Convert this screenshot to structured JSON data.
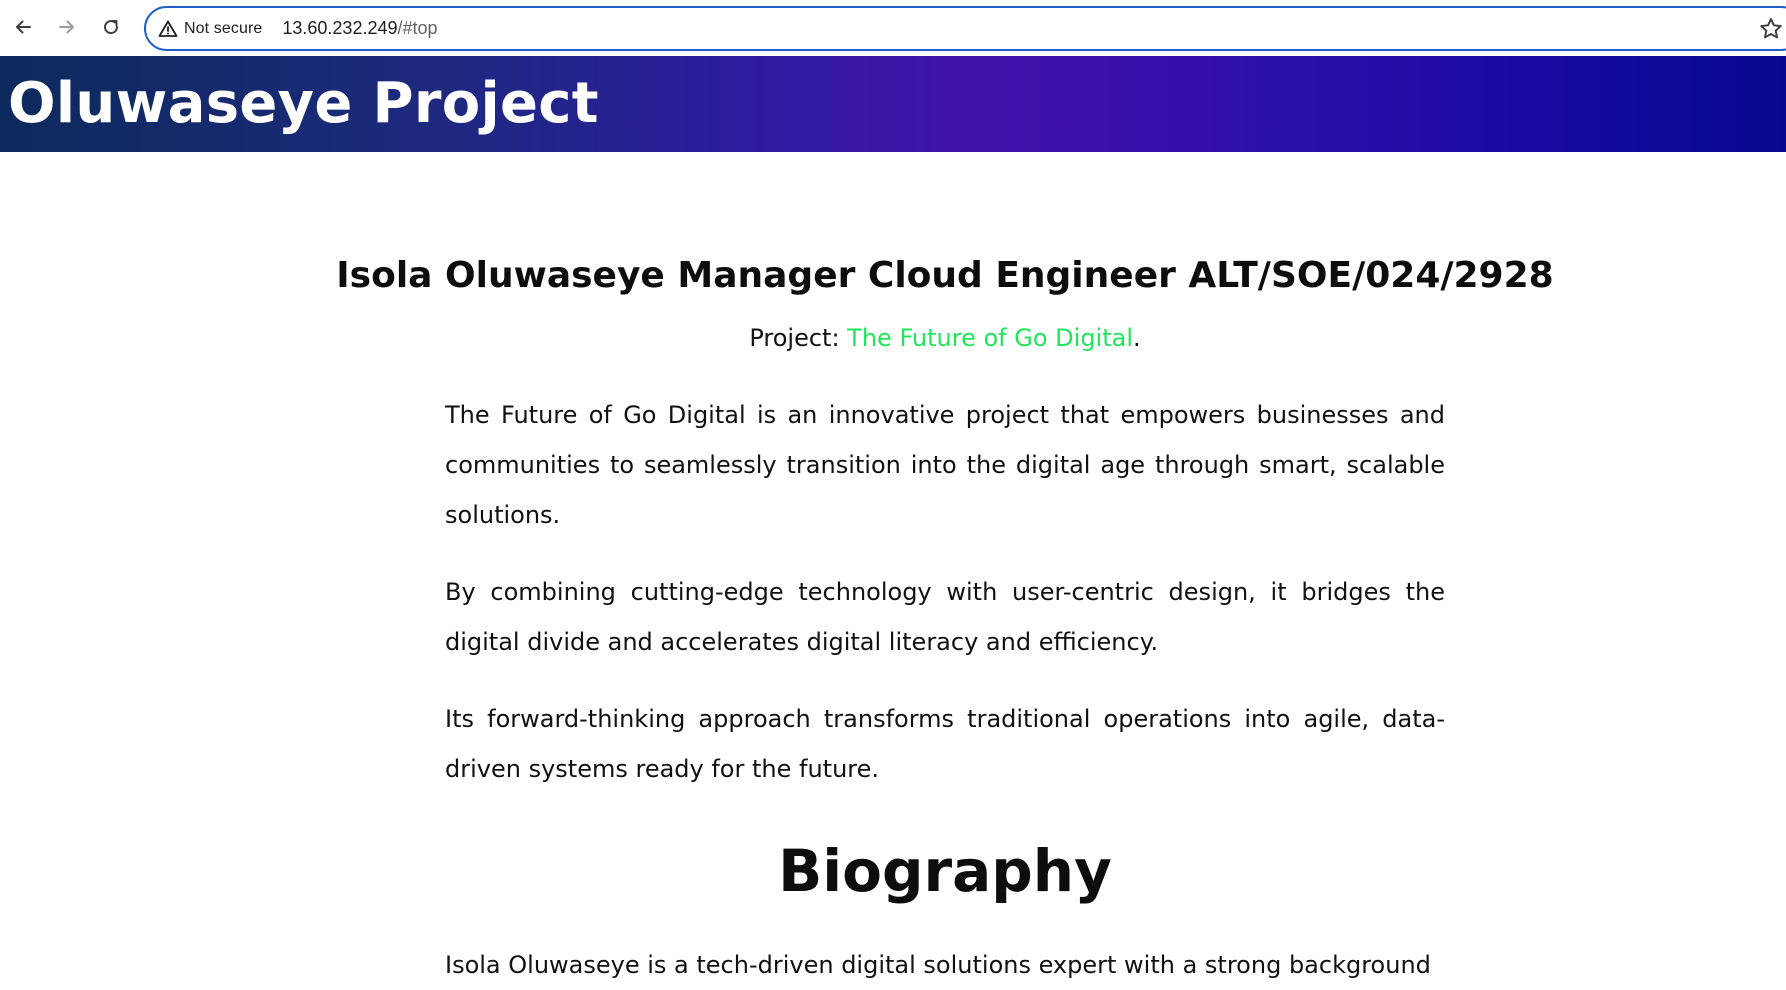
{
  "browser": {
    "back_icon": "arrow-left-icon",
    "forward_icon": "arrow-right-icon",
    "reload_icon": "reload-icon",
    "security_icon": "warning-triangle-icon",
    "security_label": "Not secure",
    "url_host": "13.60.232.249",
    "url_rest": "/#top",
    "bookmark_icon": "star-icon"
  },
  "header": {
    "title": "Oluwaseye Project",
    "gradient_colors": [
      "#0c2a5c",
      "#4312ab",
      "#07088f"
    ]
  },
  "main": {
    "author_heading": "Isola Oluwaseye Manager Cloud Engineer ALT/SOE/024/2928",
    "project_prefix": "Project: ",
    "project_name": "The Future of Go Digital",
    "project_suffix": ".",
    "project_link_color": "#1ee85a",
    "paragraphs": [
      "The Future of Go Digital is an innovative project that empowers businesses and communities to seamlessly transition into the digital age through smart, scalable solutions.",
      "By combining cutting-edge technology with user-centric design, it bridges the digital divide and accelerates digital literacy and efficiency.",
      "Its forward-thinking approach transforms traditional operations into agile, data-driven systems ready for the future."
    ],
    "biography_heading": "Biography",
    "biography_text": "Isola Oluwaseye is a tech-driven digital solutions expert with a strong background"
  }
}
